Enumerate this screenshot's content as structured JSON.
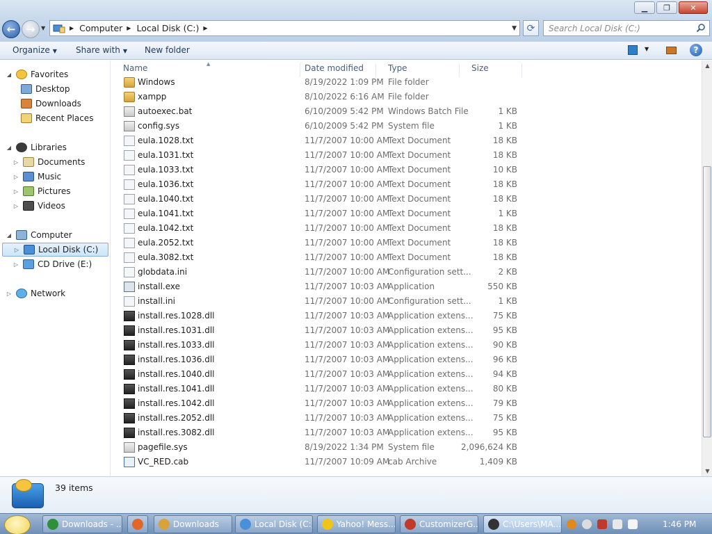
{
  "window": {
    "minimize_icon": "minimize-icon",
    "maximize_icon": "restore-icon",
    "close_icon": "close-icon"
  },
  "address": {
    "crumbs": [
      "Computer",
      "Local Disk (C:)"
    ],
    "search_placeholder": "Search Local Disk (C:)"
  },
  "toolbar": {
    "organize": "Organize",
    "share_with": "Share with",
    "new_folder": "New folder"
  },
  "nav": {
    "favorites": "Favorites",
    "desktop": "Desktop",
    "downloads": "Downloads",
    "recent_places": "Recent Places",
    "libraries": "Libraries",
    "documents": "Documents",
    "music": "Music",
    "pictures": "Pictures",
    "videos": "Videos",
    "computer": "Computer",
    "local_disk": "Local Disk (C:)",
    "cd_drive": "CD Drive (E:)",
    "network": "Network"
  },
  "columns": {
    "name": "Name",
    "date_modified": "Date modified",
    "type": "Type",
    "size": "Size"
  },
  "files": [
    {
      "name": "Windows",
      "date": "8/19/2022 1:09 PM",
      "type": "File folder",
      "size": "",
      "icon": "folder"
    },
    {
      "name": "xampp",
      "date": "8/10/2022 6:16 AM",
      "type": "File folder",
      "size": "",
      "icon": "folder"
    },
    {
      "name": "autoexec.bat",
      "date": "6/10/2009 5:42 PM",
      "type": "Windows Batch File",
      "size": "1 KB",
      "icon": "sys"
    },
    {
      "name": "config.sys",
      "date": "6/10/2009 5:42 PM",
      "type": "System file",
      "size": "1 KB",
      "icon": "sys"
    },
    {
      "name": "eula.1028.txt",
      "date": "11/7/2007 10:00 AM",
      "type": "Text Document",
      "size": "18 KB",
      "icon": "doc"
    },
    {
      "name": "eula.1031.txt",
      "date": "11/7/2007 10:00 AM",
      "type": "Text Document",
      "size": "18 KB",
      "icon": "doc"
    },
    {
      "name": "eula.1033.txt",
      "date": "11/7/2007 10:00 AM",
      "type": "Text Document",
      "size": "10 KB",
      "icon": "doc"
    },
    {
      "name": "eula.1036.txt",
      "date": "11/7/2007 10:00 AM",
      "type": "Text Document",
      "size": "18 KB",
      "icon": "doc"
    },
    {
      "name": "eula.1040.txt",
      "date": "11/7/2007 10:00 AM",
      "type": "Text Document",
      "size": "18 KB",
      "icon": "doc"
    },
    {
      "name": "eula.1041.txt",
      "date": "11/7/2007 10:00 AM",
      "type": "Text Document",
      "size": "1 KB",
      "icon": "doc"
    },
    {
      "name": "eula.1042.txt",
      "date": "11/7/2007 10:00 AM",
      "type": "Text Document",
      "size": "18 KB",
      "icon": "doc"
    },
    {
      "name": "eula.2052.txt",
      "date": "11/7/2007 10:00 AM",
      "type": "Text Document",
      "size": "18 KB",
      "icon": "doc"
    },
    {
      "name": "eula.3082.txt",
      "date": "11/7/2007 10:00 AM",
      "type": "Text Document",
      "size": "18 KB",
      "icon": "doc"
    },
    {
      "name": "globdata.ini",
      "date": "11/7/2007 10:00 AM",
      "type": "Configuration sett...",
      "size": "2 KB",
      "icon": "doc"
    },
    {
      "name": "install.exe",
      "date": "11/7/2007 10:03 AM",
      "type": "Application",
      "size": "550 KB",
      "icon": "exe"
    },
    {
      "name": "install.ini",
      "date": "11/7/2007 10:00 AM",
      "type": "Configuration sett...",
      "size": "1 KB",
      "icon": "doc"
    },
    {
      "name": "install.res.1028.dll",
      "date": "11/7/2007 10:03 AM",
      "type": "Application extens...",
      "size": "75 KB",
      "icon": "dll"
    },
    {
      "name": "install.res.1031.dll",
      "date": "11/7/2007 10:03 AM",
      "type": "Application extens...",
      "size": "95 KB",
      "icon": "dll"
    },
    {
      "name": "install.res.1033.dll",
      "date": "11/7/2007 10:03 AM",
      "type": "Application extens...",
      "size": "90 KB",
      "icon": "dll"
    },
    {
      "name": "install.res.1036.dll",
      "date": "11/7/2007 10:03 AM",
      "type": "Application extens...",
      "size": "96 KB",
      "icon": "dll"
    },
    {
      "name": "install.res.1040.dll",
      "date": "11/7/2007 10:03 AM",
      "type": "Application extens...",
      "size": "94 KB",
      "icon": "dll"
    },
    {
      "name": "install.res.1041.dll",
      "date": "11/7/2007 10:03 AM",
      "type": "Application extens...",
      "size": "80 KB",
      "icon": "dll"
    },
    {
      "name": "install.res.1042.dll",
      "date": "11/7/2007 10:03 AM",
      "type": "Application extens...",
      "size": "79 KB",
      "icon": "dll"
    },
    {
      "name": "install.res.2052.dll",
      "date": "11/7/2007 10:03 AM",
      "type": "Application extens...",
      "size": "75 KB",
      "icon": "dll"
    },
    {
      "name": "install.res.3082.dll",
      "date": "11/7/2007 10:03 AM",
      "type": "Application extens...",
      "size": "95 KB",
      "icon": "dll"
    },
    {
      "name": "pagefile.sys",
      "date": "8/19/2022 1:34 PM",
      "type": "System file",
      "size": "2,096,624 KB",
      "icon": "sys"
    },
    {
      "name": "VC_RED.cab",
      "date": "11/7/2007 10:09 AM",
      "type": "cab Archive",
      "size": "1,409 KB",
      "icon": "cab"
    }
  ],
  "status": {
    "count": "39 items"
  },
  "taskbar": {
    "items": [
      {
        "label": "Downloads - ...",
        "icon_color": "#2f8f3a"
      },
      {
        "label": "",
        "icon_color": "#e0662a"
      },
      {
        "label": "Downloads",
        "icon_color": "#d9a23b"
      },
      {
        "label": "Local Disk (C:)",
        "icon_color": "#4a90d9"
      },
      {
        "label": "Yahoo! Mess...",
        "icon_color": "#f0c419"
      },
      {
        "label": "CustomizerG...",
        "icon_color": "#c0392b"
      },
      {
        "label": "C:\\Users\\MA...",
        "icon_color": "#333333"
      }
    ],
    "clock": "1:46 PM"
  }
}
